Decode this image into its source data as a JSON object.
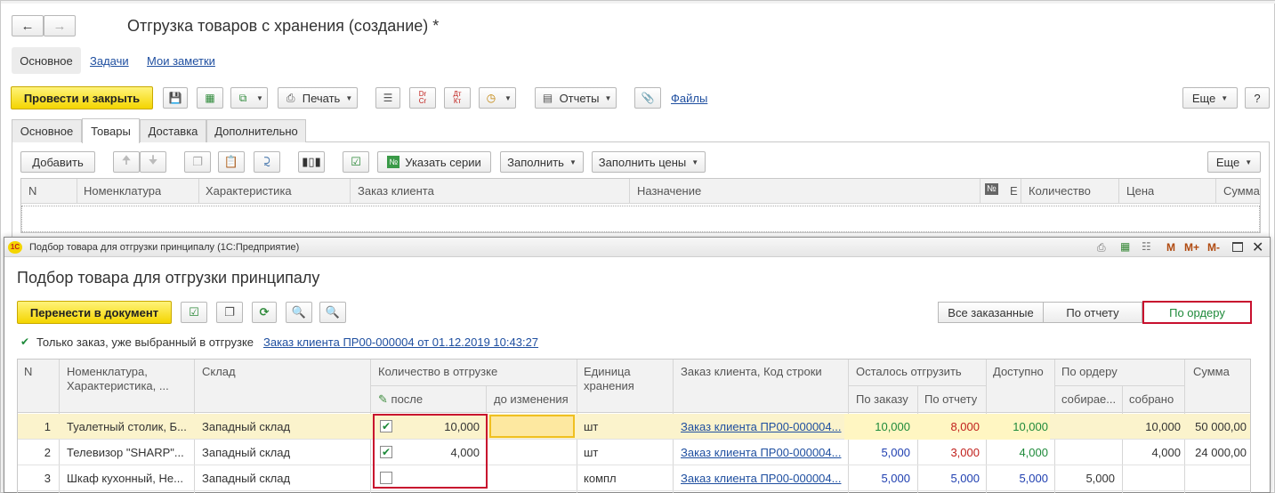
{
  "doc": {
    "title": "Отгрузка товаров с хранения (создание) *",
    "nav_tabs": [
      "Основное",
      "Задачи",
      "Мои заметки"
    ],
    "post_close_label": "Провести и закрыть",
    "print_label": "Печать",
    "reports_label": "Отчеты",
    "files_label": "Файлы",
    "more_label": "Еще",
    "help_label": "?",
    "dt_icon": "Dт\nCr",
    "tabs": [
      "Основное",
      "Товары",
      "Доставка",
      "Дополнительно"
    ],
    "active_tab": "Товары",
    "goods_toolbar": {
      "add": "Добавить",
      "series": "Указать серии",
      "fill": "Заполнить",
      "fill_prices": "Заполнить цены",
      "more": "Еще"
    },
    "goods_columns": [
      "N",
      "Номенклатура",
      "Характеристика",
      "Заказ клиента",
      "Назначение",
      "№",
      "Е",
      "Количество",
      "Цена",
      "Сумма"
    ]
  },
  "dialog": {
    "window_title": "Подбор товара для отгрузки принципалу  (1С:Предприятие)",
    "heading": "Подбор товара для отгрузки принципалу",
    "transfer_label": "Перенести в документ",
    "mode_buttons": [
      "Все заказанные",
      "По отчету",
      "По ордеру"
    ],
    "active_mode": "По ордеру",
    "filter_checkbox_label": "Только заказ, уже выбранный в отгрузке",
    "order_link": "Заказ клиента ПР00-000004 от 01.12.2019 10:43:27",
    "titlebar_icons": [
      "M",
      "M+",
      "M-"
    ],
    "columns": {
      "n": "N",
      "item": "Номенклатура,\nХарактеристика, ...",
      "warehouse": "Склад",
      "qty_group": "Количество в отгрузке",
      "qty_after": "после",
      "qty_before": "до изменения",
      "unit": "Единица\nхранения",
      "order": "Заказ клиента, Код строки",
      "left_group": "Осталось отгрузить",
      "by_order": "По заказу",
      "by_report": "По отчету",
      "available": "Доступно",
      "warrant_group": "По ордеру",
      "collecting": "собирае...",
      "collected": "собрано",
      "sum": "Сумма"
    },
    "rows": [
      {
        "n": "1",
        "item": "Туалетный столик, Б...",
        "warehouse": "Западный склад",
        "checked": true,
        "qty": "10,000",
        "before": "",
        "unit": "шт",
        "order": "Заказ клиента ПР00-000004...",
        "by_order": "10,000",
        "by_report": "8,000",
        "available": "10,000",
        "collecting": "",
        "collected": "10,000",
        "sum": "50 000,00"
      },
      {
        "n": "2",
        "item": "Телевизор \"SHARP\"...",
        "warehouse": "Западный склад",
        "checked": true,
        "qty": "4,000",
        "before": "",
        "unit": "шт",
        "order": "Заказ клиента ПР00-000004...",
        "by_order": "5,000",
        "by_report": "3,000",
        "available": "4,000",
        "collecting": "",
        "collected": "4,000",
        "sum": "24 000,00"
      },
      {
        "n": "3",
        "item": "Шкаф кухонный, Не...",
        "warehouse": "Западный склад",
        "checked": false,
        "qty": "",
        "before": "",
        "unit": "компл",
        "order": "Заказ клиента ПР00-000004...",
        "by_order": "5,000",
        "by_report": "5,000",
        "available": "5,000",
        "collecting": "5,000",
        "collected": "",
        "sum": ""
      }
    ],
    "colors": {
      "accent_yellow": "#f4d500",
      "row_selected": "#fbf3cc",
      "green": "#1e8a3a",
      "red": "#c0201c",
      "blue": "#1f3fb0",
      "highlight_border": "#c8102e"
    }
  }
}
